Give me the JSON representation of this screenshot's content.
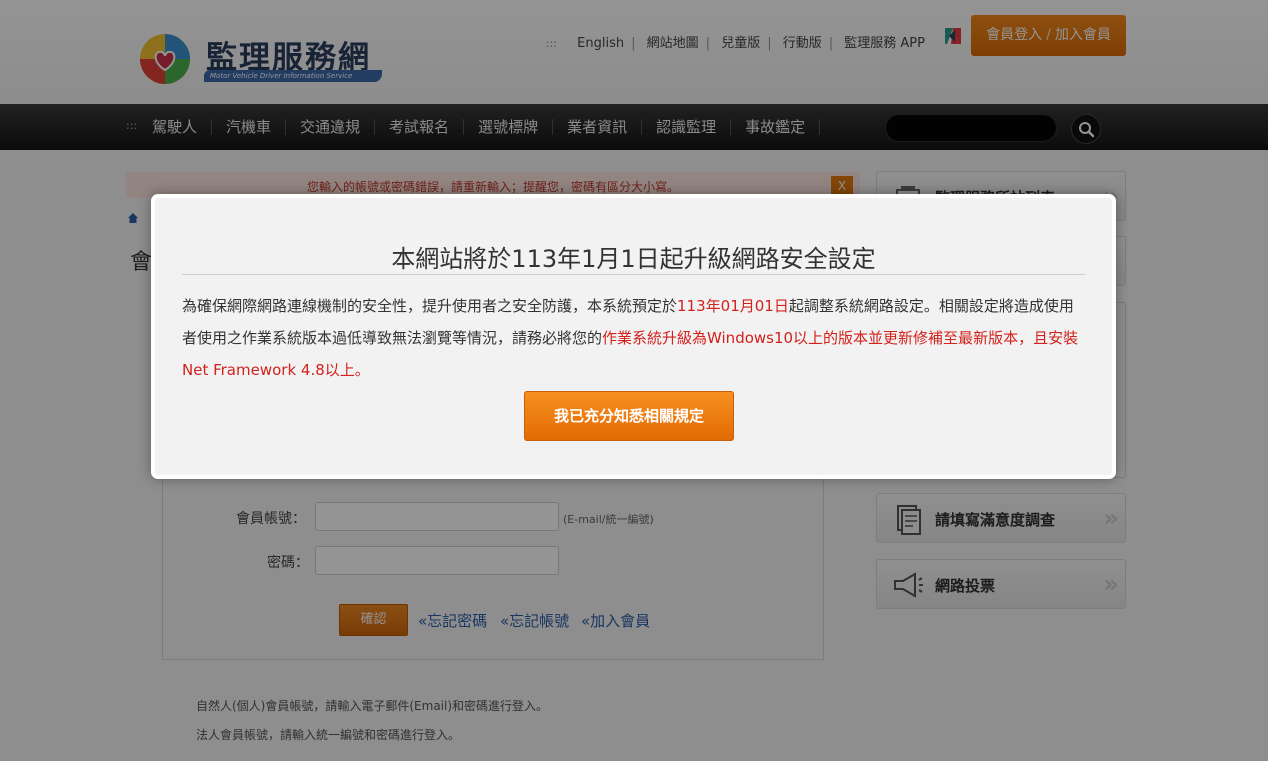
{
  "header": {
    "logo_text": "監理服務網",
    "logo_sub": "Motor Vehicle Driver Information Service",
    "toplinks": [
      "English",
      "網站地圖",
      "兒童版",
      "行動版",
      "監理服務 APP"
    ],
    "login_label": "會員登入",
    "join_label": "加入會員"
  },
  "nav": {
    "items": [
      "駕駛人",
      "汽機車",
      "交通違規",
      "考試報名",
      "選號標牌",
      "業者資訊",
      "認識監理",
      "事故鑑定"
    ]
  },
  "main": {
    "alert_text": "您輸入的帳號或密碼錯誤，請重新輸入；提醒您，密碼有區分大小寫。",
    "alert_close": "X",
    "page_heading": "會",
    "account_label": "會員帳號：",
    "account_hint": "(E-mail/統一編號)",
    "password_label": "密碼：",
    "confirm_label": "確認",
    "link_forgot_password": "«忘記密碼",
    "link_forgot_account": "«忘記帳號",
    "link_join": "«加入會員",
    "note_1": "自然人(個人)會員帳號，請輸入電子郵件(Email)和密碼進行登入。",
    "note_2": "法人會員帳號，請輸入統一編號和密碼進行登入。"
  },
  "sidebar": {
    "item_1": "監理服務所站列表",
    "item_2": "請填寫滿意度調查",
    "item_3": "網路投票"
  },
  "modal": {
    "title": "本網站將於113年1月1日起升級網路安全設定",
    "body_1": "為確保網際網路連線機制的安全性，提升使用者之安全防護，本系統預定於",
    "body_date": "113年01月01日",
    "body_2": "起調整系統網路設定。相關設定將造成使用者使用之作業系統版本過低導致無法瀏覽等情況，請務必將您的",
    "body_red": "作業系統升級為Windows10以上的版本並更新修補至最新版本，且安裝Net Framework 4.8以上。",
    "button_label": "我已充分知悉相關規定"
  },
  "colors": {
    "accent_orange": "#e8770d",
    "alert_red": "#d3211c",
    "nav_dark": "#1e1e1e"
  }
}
